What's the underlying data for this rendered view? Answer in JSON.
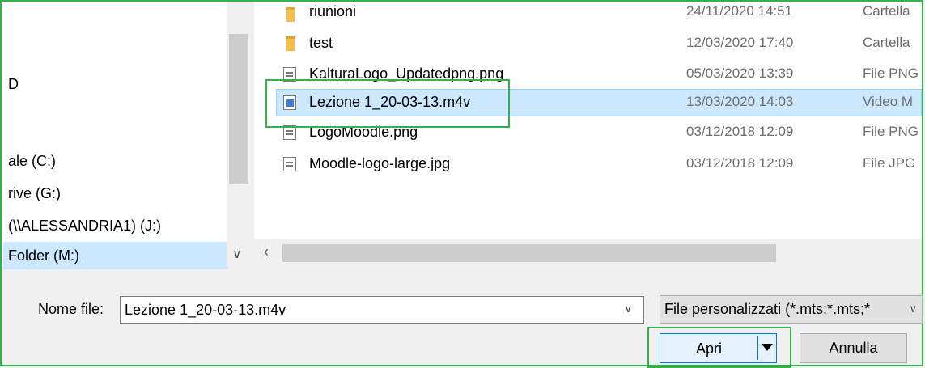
{
  "nav_pane": {
    "items": [
      {
        "label": "D"
      },
      {
        "label": "ale (C:)"
      },
      {
        "label": "rive (G:)"
      },
      {
        "label": " (\\\\ALESSANDRIA1) (J:)"
      },
      {
        "label": "Folder (M:)"
      }
    ]
  },
  "files": [
    {
      "name": "riunioni",
      "date": "24/11/2020 14:51",
      "type": "Cartella",
      "icon": "folder-icon"
    },
    {
      "name": "test",
      "date": "12/03/2020 17:40",
      "type": "Cartella",
      "icon": "folder-icon"
    },
    {
      "name": "KalturaLogo_Updatedpng.png",
      "date": "05/03/2020 13:39",
      "type": "File PNG",
      "icon": "image-file-icon"
    },
    {
      "name": "Lezione 1_20-03-13.m4v",
      "date": "13/03/2020 14:03",
      "type": "Video M",
      "icon": "video-file-icon"
    },
    {
      "name": "LogoMoodle.png",
      "date": "03/12/2018 12:09",
      "type": "File PNG",
      "icon": "image-file-icon"
    },
    {
      "name": "Moodle-logo-large.jpg",
      "date": "03/12/2018 12:09",
      "type": "File JPG",
      "icon": "image-file-icon"
    }
  ],
  "footer": {
    "file_name_label": "Nome file:",
    "file_name_value": "Lezione 1_20-03-13.m4v",
    "filter_value": "File personalizzati (*.mts;*.mts;*",
    "open_label": "Apri",
    "cancel_label": "Annulla"
  },
  "colors": {
    "highlight_box": "#33b24a",
    "selection": "#cce8ff",
    "accent": "#0078d7"
  }
}
